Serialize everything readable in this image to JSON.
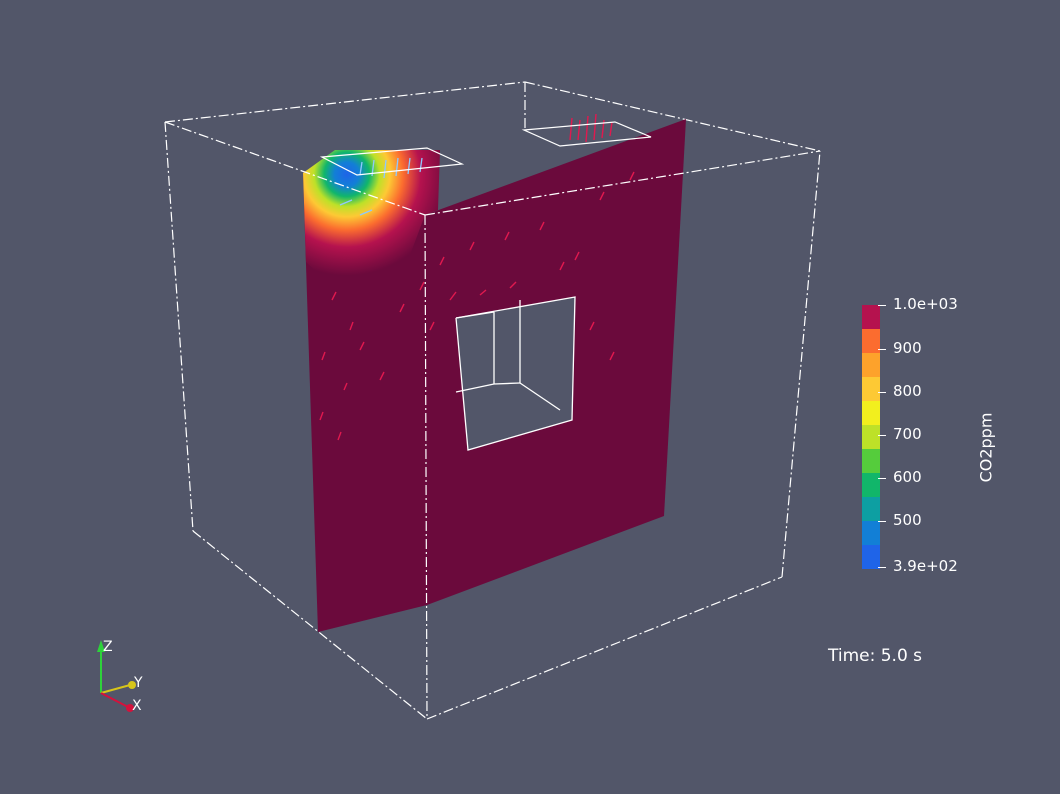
{
  "scene": {
    "background": "#525669",
    "slice_color": "#6b0a3c",
    "outline_color": "#ffffff"
  },
  "colorbar": {
    "title": "CO2ppm",
    "ticks": [
      "1.0e+03",
      "900",
      "800",
      "700",
      "600",
      "500",
      "3.9e+02"
    ],
    "colors": [
      "#b5124e",
      "#fb6c2f",
      "#fda22b",
      "#fdc934",
      "#f2ef1e",
      "#bde128",
      "#55cc3c",
      "#11b66a",
      "#0d9fa2",
      "#127fd6",
      "#1f64e8"
    ]
  },
  "time": {
    "label": "Time: 5.0 s"
  },
  "orientation_axes": {
    "z_label": "Z",
    "y_label": "Y",
    "x_label": "X",
    "z_color": "#2ed23a",
    "y_color": "#d7c51a",
    "x_color": "#d4123c"
  }
}
